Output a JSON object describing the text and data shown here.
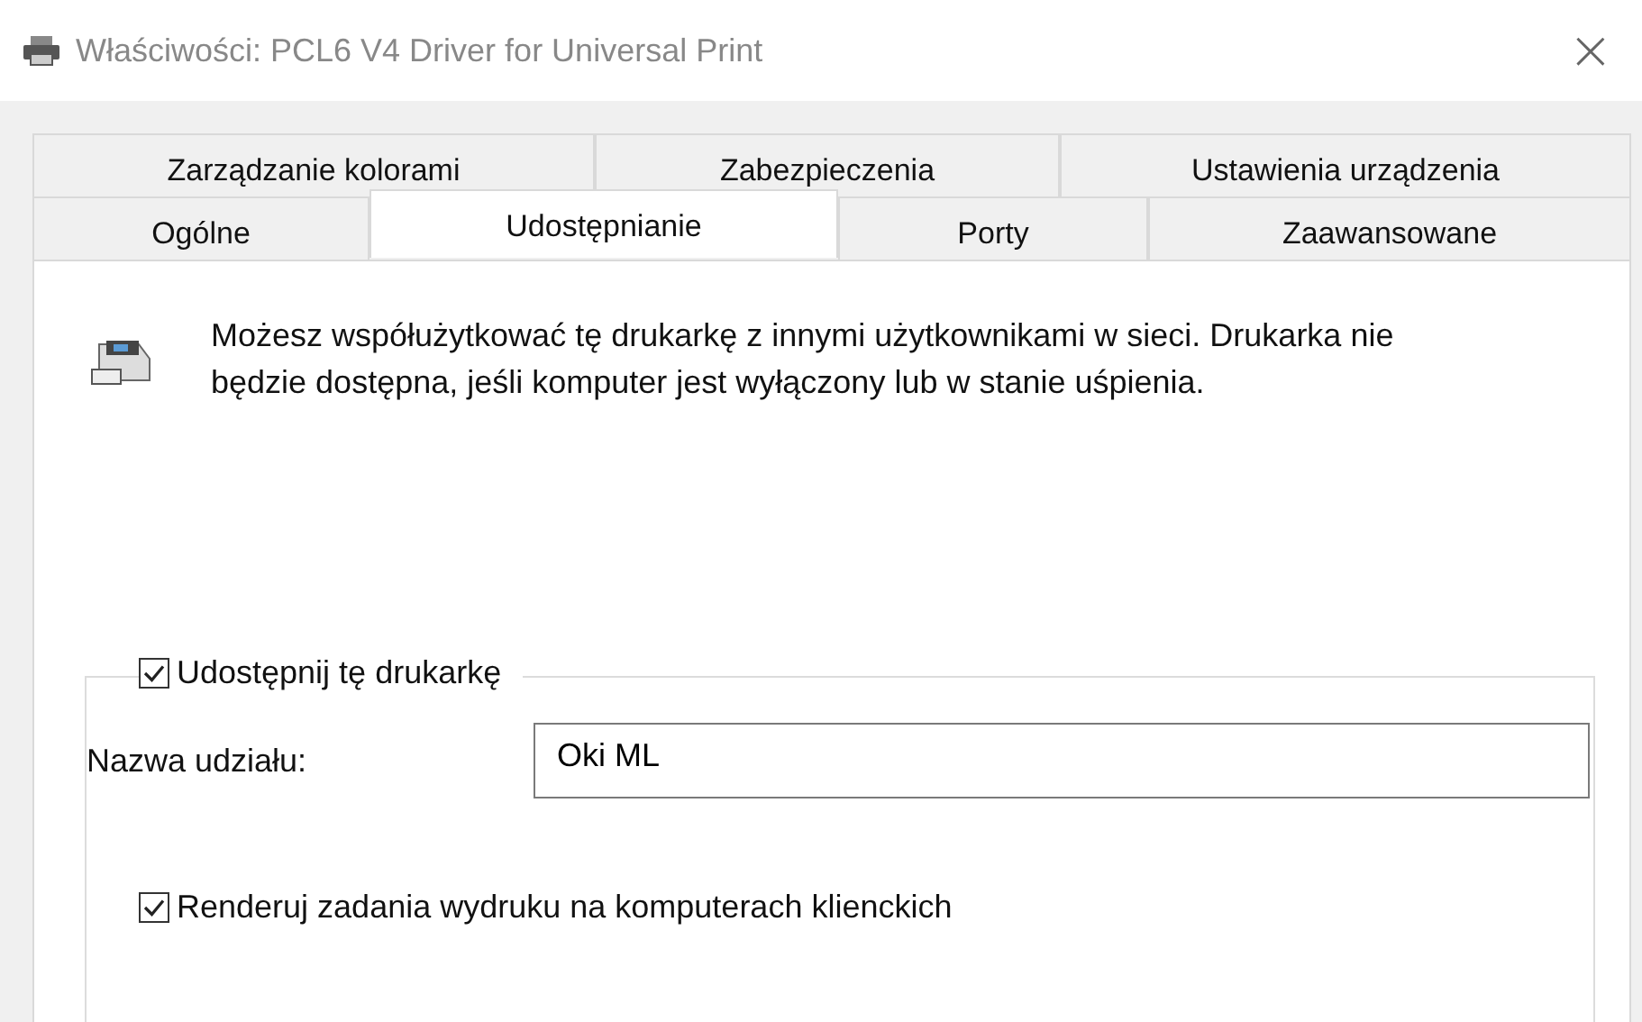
{
  "window": {
    "title": "Właściwości: PCL6 V4 Driver for Universal Print",
    "close": "×"
  },
  "tab_rows": [
    {
      "tabs": [
        {
          "label": "Zarządzanie kolorami",
          "selected": false
        },
        {
          "label": "Zabezpieczenia",
          "selected": false
        },
        {
          "label": "Ustawienia urządzenia",
          "selected": false
        }
      ]
    },
    {
      "tabs": [
        {
          "label": "Ogólne",
          "selected": false
        },
        {
          "label": "Udostępnianie",
          "selected": true
        },
        {
          "label": "Porty",
          "selected": false
        },
        {
          "label": "Zaawansowane",
          "selected": false
        }
      ]
    }
  ],
  "description": "Możesz współużytkować tę drukarkę z innymi użytkownikami w sieci. Drukarka nie będzie dostępna, jeśli komputer jest wyłączony lub w stanie uśpienia.",
  "share": {
    "label": "Udostępnij tę drukarkę",
    "checked": true
  },
  "share_name": {
    "label": "Nazwa udziału:",
    "value": "Oki ML"
  },
  "render": {
    "label": "Renderuj zadania wydruku na komputerach klienckich",
    "checked": true
  }
}
